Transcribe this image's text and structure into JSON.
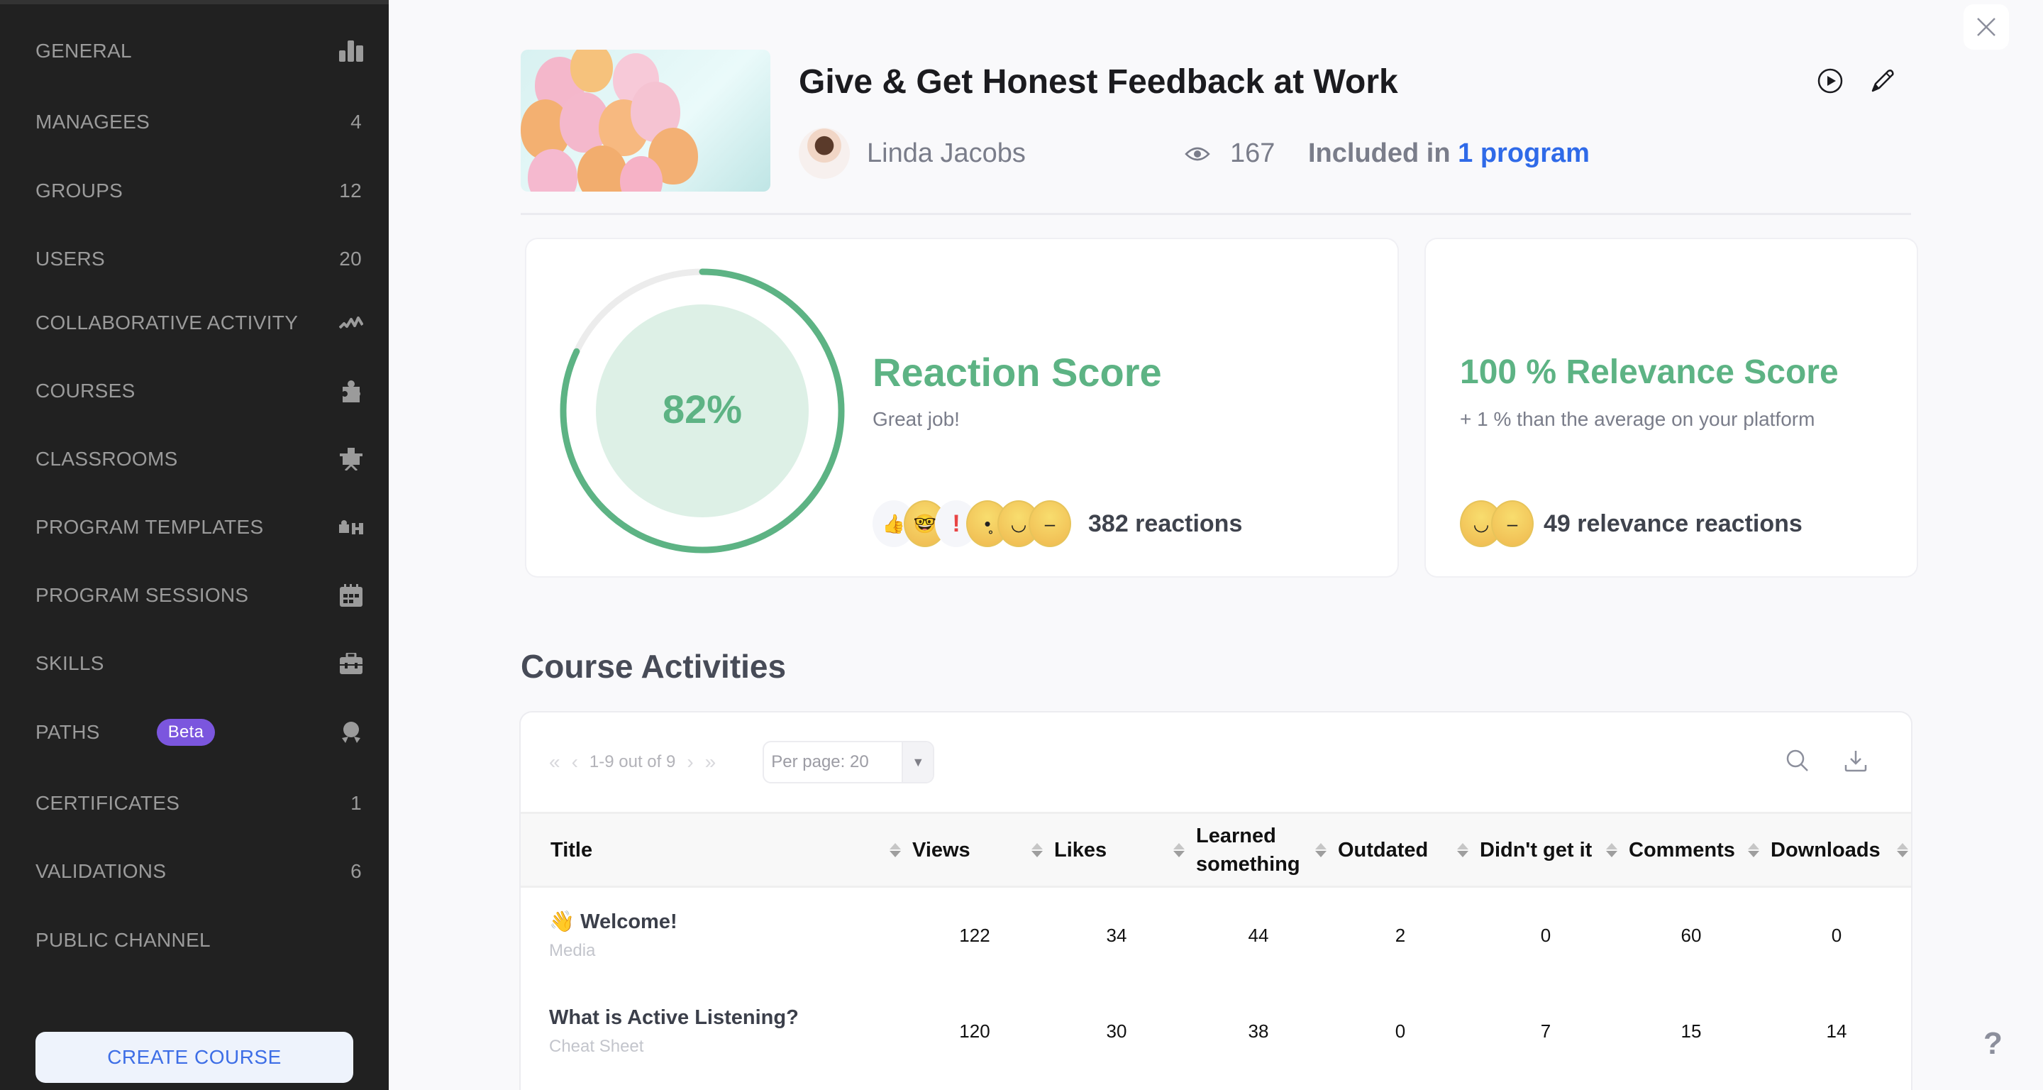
{
  "sidebar": {
    "items": [
      {
        "label": "GENERAL",
        "count": null,
        "icon": "bar-chart-icon"
      },
      {
        "label": "MANAGEES",
        "count": "4",
        "icon": null
      },
      {
        "label": "GROUPS",
        "count": "12",
        "icon": null
      },
      {
        "label": "USERS",
        "count": "20",
        "icon": null
      },
      {
        "label": "COLLABORATIVE ACTIVITY",
        "count": null,
        "icon": "activity-icon"
      },
      {
        "label": "COURSES",
        "count": null,
        "icon": "puzzle-icon"
      },
      {
        "label": "CLASSROOMS",
        "count": null,
        "icon": "presentation-icon"
      },
      {
        "label": "PROGRAM TEMPLATES",
        "count": null,
        "icon": "program-template-icon"
      },
      {
        "label": "PROGRAM SESSIONS",
        "count": null,
        "icon": "calendar-icon"
      },
      {
        "label": "SKILLS",
        "count": null,
        "icon": "briefcase-icon"
      },
      {
        "label": "PATHS",
        "count": null,
        "icon": "award-icon",
        "badge": "Beta"
      },
      {
        "label": "CERTIFICATES",
        "count": "1",
        "icon": null
      },
      {
        "label": "VALIDATIONS",
        "count": "6",
        "icon": null
      },
      {
        "label": "PUBLIC CHANNEL",
        "count": null,
        "icon": null
      }
    ],
    "create_button": "CREATE COURSE"
  },
  "course": {
    "title": "Give & Get Honest Feedback at Work",
    "author": "Linda Jacobs",
    "views": "167",
    "included_prefix": "Included in",
    "included_link": "1 program"
  },
  "reaction_card": {
    "percent_label": "82%",
    "percent_value": 82,
    "title": "Reaction Score",
    "subtitle": "Great job!",
    "reaction_count": "382 reactions",
    "emojis": [
      "thumbs-up",
      "nerd-face",
      "exclamation",
      "surprised-face",
      "smiling-face",
      "neutral-face"
    ]
  },
  "relevance_card": {
    "title": "100 % Relevance Score",
    "subtitle": "+ 1 % than the average on your platform",
    "reaction_count": "49 relevance reactions",
    "emojis": [
      "smiling-face",
      "neutral-face"
    ]
  },
  "activities": {
    "section_title": "Course Activities",
    "pagination": "1-9 out of 9",
    "per_page": "Per page: 20",
    "columns": [
      "Title",
      "Views",
      "Likes",
      "Learned something",
      "Outdated",
      "Didn't get it",
      "Comments",
      "Downloads"
    ],
    "rows": [
      {
        "icon": "👋",
        "title": "Welcome!",
        "type": "Media",
        "values": [
          "122",
          "34",
          "44",
          "2",
          "0",
          "60",
          "0"
        ]
      },
      {
        "icon": "",
        "title": "What is Active Listening?",
        "type": "Cheat Sheet",
        "values": [
          "120",
          "30",
          "38",
          "0",
          "7",
          "15",
          "14"
        ]
      }
    ]
  },
  "colors": {
    "accent_green": "#5db384",
    "link_blue": "#2f6ae8",
    "beta_purple": "#7b56de",
    "sidebar_bg": "#212121"
  },
  "help_label": "?"
}
